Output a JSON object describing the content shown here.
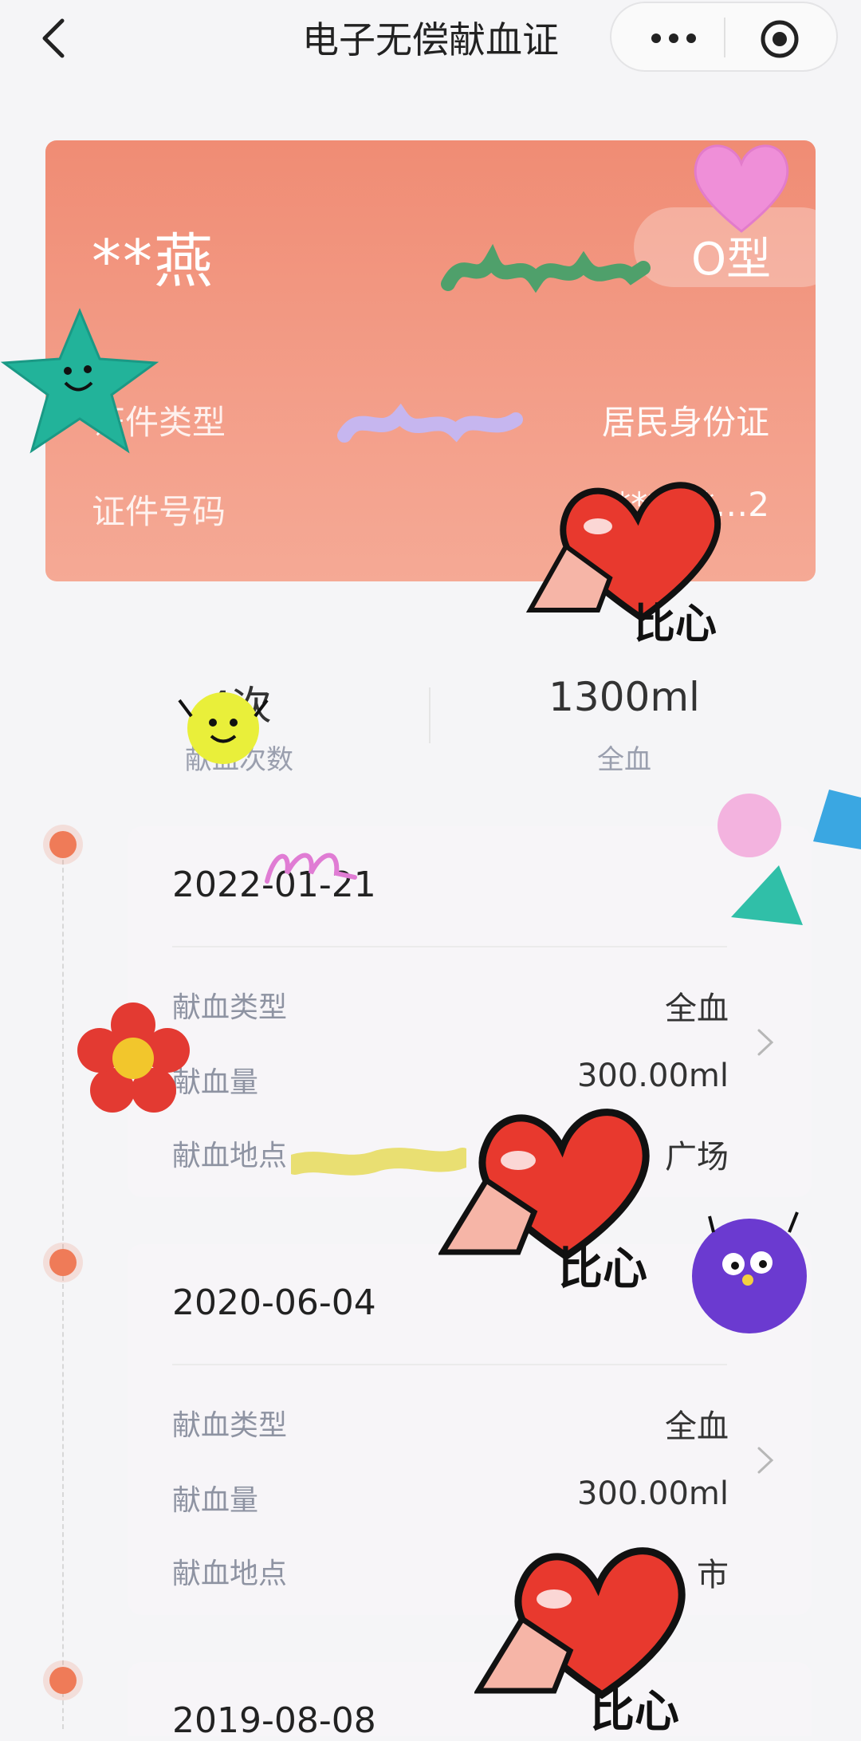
{
  "header": {
    "title": "电子无偿献血证",
    "icons": {
      "back": "chevron-left-icon",
      "more": "more-dots-icon",
      "close": "target-circle-icon"
    }
  },
  "card": {
    "name": "**燕",
    "blood_type": "O型",
    "id_type_label": "证件类型",
    "id_type_value": "居民身份证",
    "id_number_label": "证件号码",
    "id_number_value": "******…2"
  },
  "stats": [
    {
      "value": "4次",
      "label": "献血次数"
    },
    {
      "value": "1300ml",
      "label": "全血"
    }
  ],
  "records": [
    {
      "date": "2022-01-21",
      "type_label": "献血类型",
      "type_value": "全血",
      "amount_label": "献血量",
      "amount_value": "300.00ml",
      "place_label": "献血地点",
      "place_value": "广场"
    },
    {
      "date": "2020-06-04",
      "type_label": "献血类型",
      "type_value": "全血",
      "amount_label": "献血量",
      "amount_value": "300.00ml",
      "place_label": "献血地点",
      "place_value": "市"
    },
    {
      "date": "2019-08-08"
    }
  ],
  "stickers": {
    "text": "比心"
  },
  "colors": {
    "card": "#f39d88",
    "timeline_dot": "#ef7b58",
    "heart": "#e8392e"
  }
}
